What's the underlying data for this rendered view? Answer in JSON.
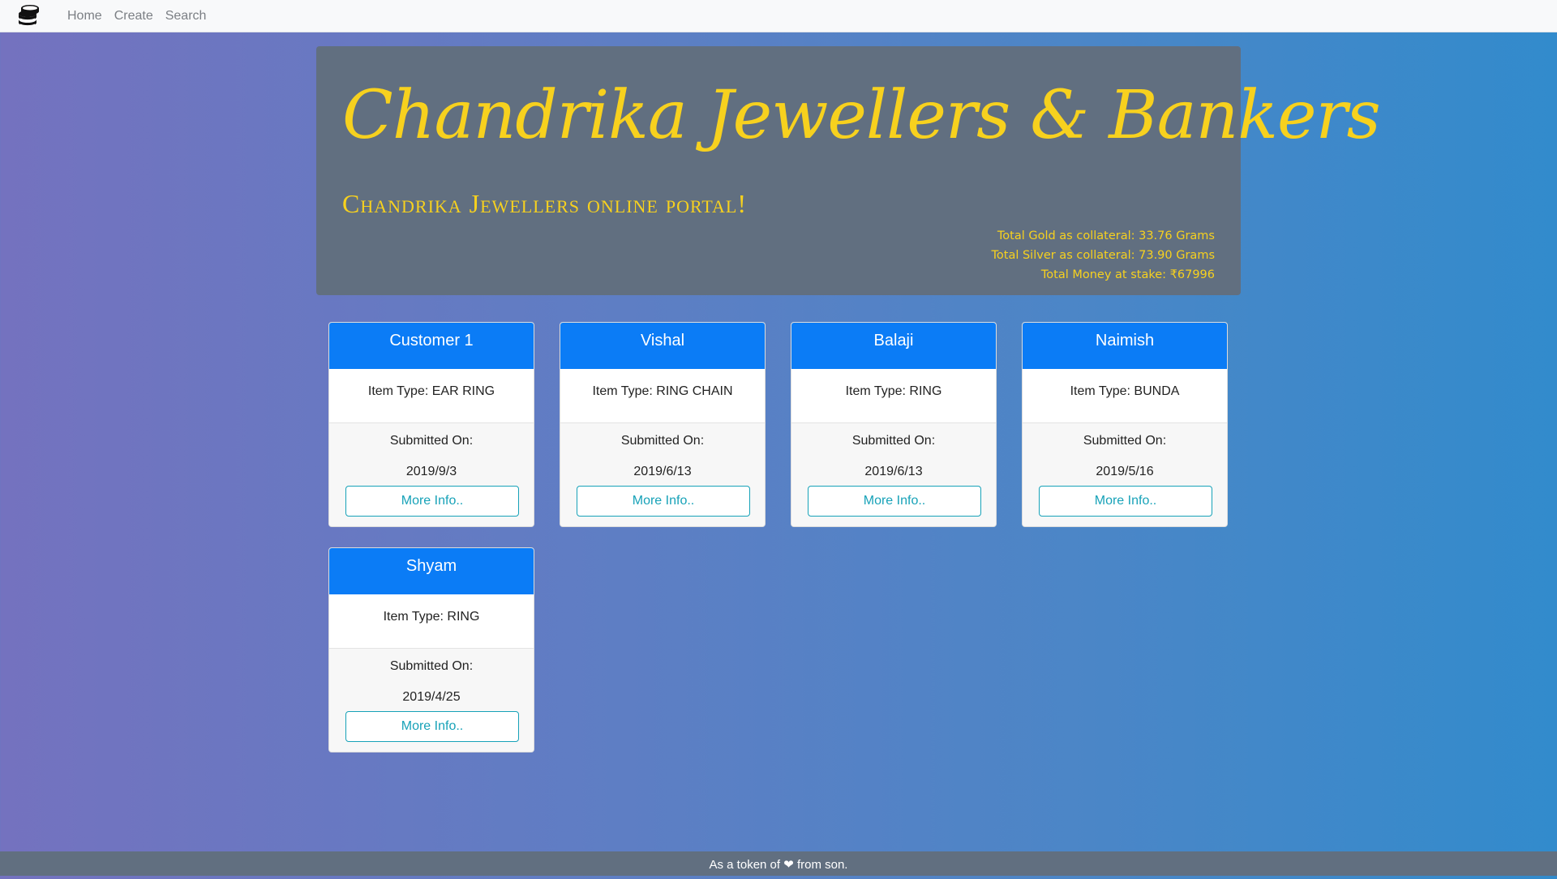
{
  "nav": {
    "brand_icon": "coin-stack-icon",
    "links": [
      "Home",
      "Create",
      "Search"
    ]
  },
  "header": {
    "title": "Chandrika Jewellers & Bankers",
    "subtitle": "Chandrika Jewellers online portal!",
    "stats": [
      "Total Gold as collateral: 33.76 Grams",
      "Total Silver as collateral: 73.90 Grams",
      "Total Money at stake: ₹67996"
    ]
  },
  "cards": [
    {
      "name": "Customer 1",
      "item_type": "Item Type: EAR RING",
      "submitted_label": "Submitted On:",
      "date": "2019/9/3",
      "button": "More Info.."
    },
    {
      "name": "Vishal",
      "item_type": "Item Type: RING CHAIN",
      "submitted_label": "Submitted On:",
      "date": "2019/6/13",
      "button": "More Info.."
    },
    {
      "name": "Balaji",
      "item_type": "Item Type: RING",
      "submitted_label": "Submitted On:",
      "date": "2019/6/13",
      "button": "More Info.."
    },
    {
      "name": "Naimish",
      "item_type": "Item Type: BUNDA",
      "submitted_label": "Submitted On:",
      "date": "2019/5/16",
      "button": "More Info.."
    },
    {
      "name": "Shyam",
      "item_type": "Item Type: RING",
      "submitted_label": "Submitted On:",
      "date": "2019/4/25",
      "button": "More Info.."
    }
  ],
  "footer": {
    "text": "As a token of ❤ from son."
  },
  "colors": {
    "accent_gold": "#f7d11e",
    "card_header_blue": "#0b7cf6",
    "button_teal": "#17a2b8"
  }
}
